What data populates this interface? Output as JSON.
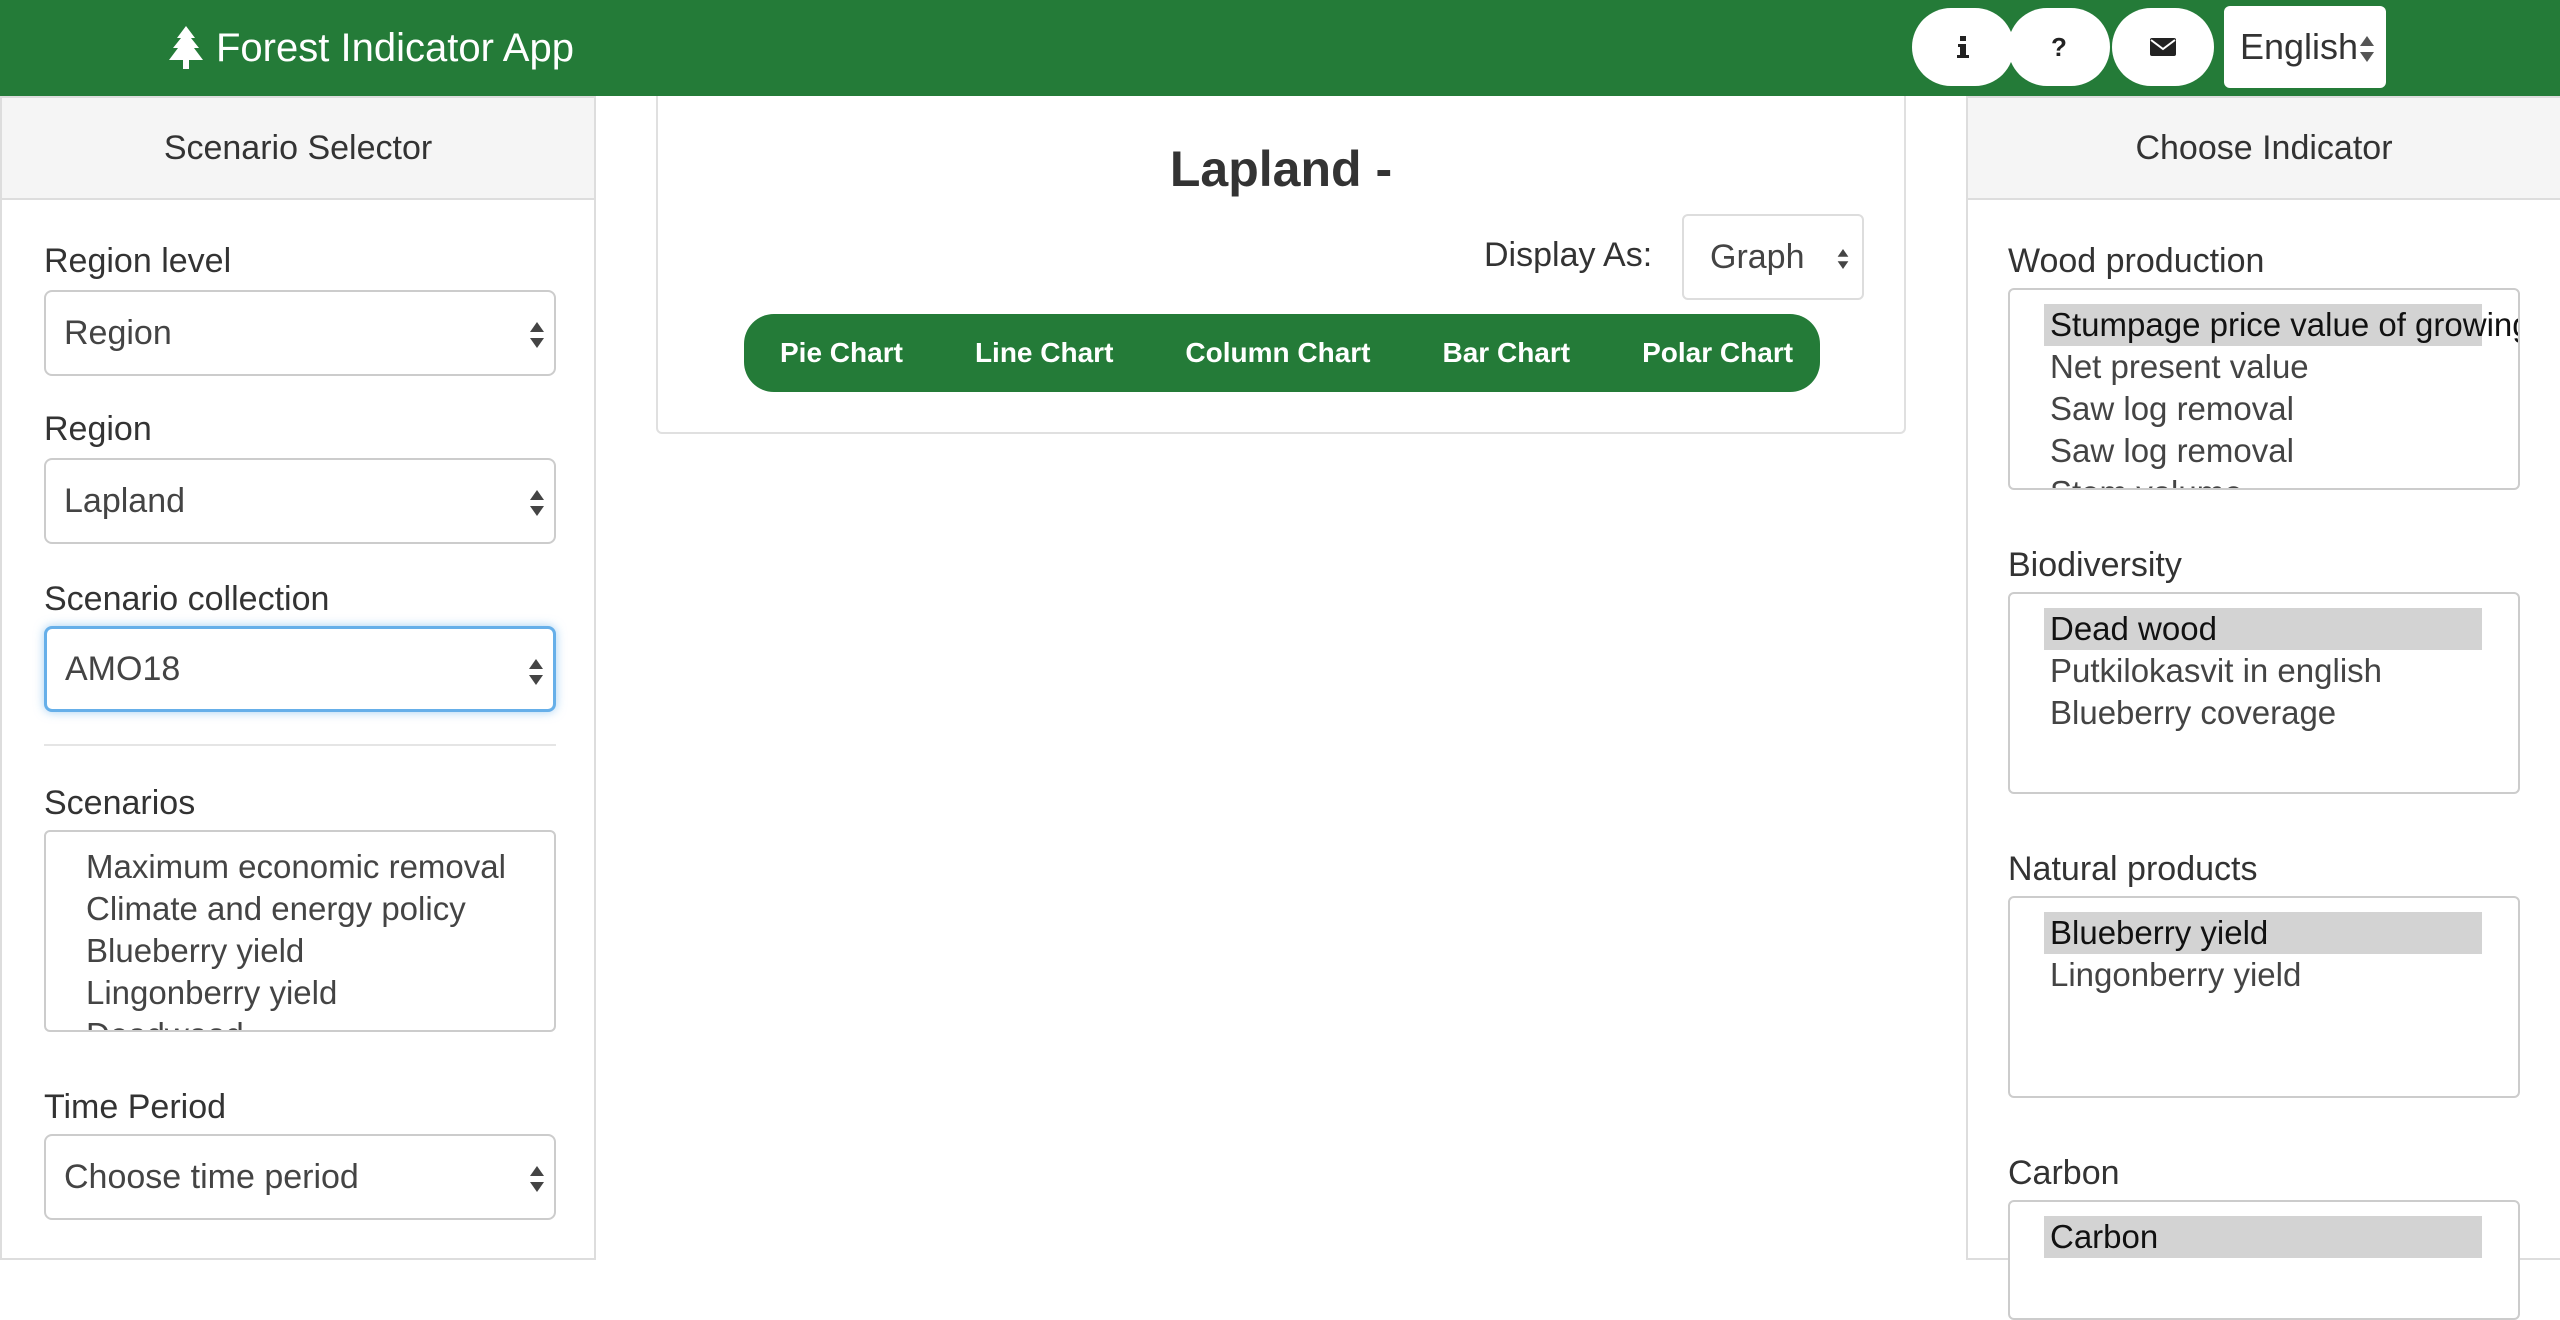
{
  "navbar": {
    "app_title": "Forest Indicator App",
    "info_icon": "info-icon",
    "help_icon": "question-icon",
    "contact_icon": "envelope-icon",
    "language": "English",
    "brand_color": "#247b38"
  },
  "scenario_selector": {
    "heading": "Scenario Selector",
    "region_level": {
      "label": "Region level",
      "value": "Region"
    },
    "region": {
      "label": "Region",
      "value": "Lapland"
    },
    "scenario_collection": {
      "label": "Scenario collection",
      "value": "AMO18"
    },
    "scenarios": {
      "label": "Scenarios",
      "options": [
        "Maximum economic removal",
        "Climate and energy policy",
        "Blueberry yield",
        "Lingonberry yield",
        "Deadwood"
      ]
    },
    "time_period": {
      "label": "Time Period",
      "placeholder": "Choose time period"
    }
  },
  "main": {
    "title": "Lapland -",
    "display_as_label": "Display As:",
    "display_as_value": "Graph",
    "chart_buttons": [
      "Pie Chart",
      "Line Chart",
      "Column Chart",
      "Bar Chart",
      "Polar Chart"
    ]
  },
  "indicators": {
    "heading": "Choose Indicator",
    "groups": [
      {
        "label": "Wood production",
        "options": [
          "Stumpage price value of growing stock",
          "Net present value",
          "Saw log removal",
          "Saw log removal",
          "Stem volume"
        ],
        "selected": 0
      },
      {
        "label": "Biodiversity",
        "options": [
          "Dead wood",
          "Putkilokasvit in english",
          "Blueberry coverage"
        ],
        "selected": 0
      },
      {
        "label": "Natural products",
        "options": [
          "Blueberry yield",
          "Lingonberry yield"
        ],
        "selected": 0
      },
      {
        "label": "Carbon",
        "options": [
          "Carbon"
        ],
        "selected": 0
      }
    ]
  }
}
